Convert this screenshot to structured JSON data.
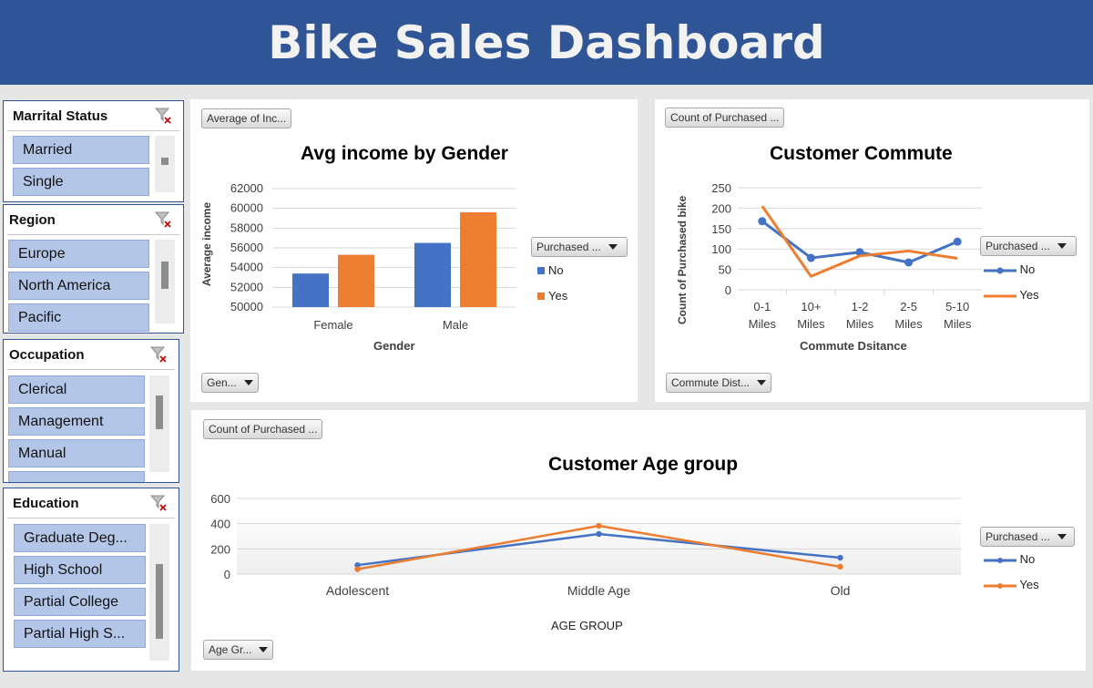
{
  "header": {
    "title": "Bike Sales Dashboard"
  },
  "slicers": [
    {
      "title": "Marrital Status",
      "items": [
        "Married",
        "Single"
      ]
    },
    {
      "title": "Region",
      "items": [
        "Europe",
        "North America",
        "Pacific"
      ]
    },
    {
      "title": "Occupation",
      "items": [
        "Clerical",
        "Management",
        "Manual"
      ]
    },
    {
      "title": "Education",
      "items": [
        "Graduate Deg...",
        "High School",
        "Partial College",
        "Partial High S..."
      ]
    }
  ],
  "colors": {
    "no": "#4472c4",
    "yes": "#ed7d31",
    "header": "#2f5597",
    "slicer_item": "#b4c6e7"
  },
  "charts": {
    "income": {
      "value_button": "Average of Inc...",
      "field_button": "Gen...",
      "legend_button": "Purchased ...",
      "ylabel": "Average income",
      "xlabel": "Gender",
      "legend": [
        "No",
        "Yes"
      ],
      "ticks": [
        "62000",
        "60000",
        "58000",
        "56000",
        "54000",
        "52000",
        "50000"
      ]
    },
    "commute": {
      "value_button": "Count of Purchased ...",
      "field_button": "Commute Dist...",
      "legend_button": "Purchased ...",
      "ylabel": "Count of Purchased bike",
      "xlabel": "Commute Dsitance",
      "legend": [
        "No",
        "Yes"
      ],
      "ticks": [
        "250",
        "200",
        "150",
        "100",
        "50",
        "0"
      ]
    },
    "age": {
      "value_button": "Count of Purchased ...",
      "field_button": "Age Gr...",
      "legend_button": "Purchased ...",
      "xlabel": "AGE GROUP",
      "legend": [
        "No",
        "Yes"
      ],
      "ticks": [
        "600",
        "400",
        "200",
        "0"
      ]
    }
  },
  "chart_data": [
    {
      "type": "bar",
      "title": "Avg income by Gender",
      "xlabel": "Gender",
      "ylabel": "Average income",
      "categories": [
        "Female",
        "Male"
      ],
      "series": [
        {
          "name": "No",
          "values": [
            53400,
            56500
          ]
        },
        {
          "name": "Yes",
          "values": [
            55300,
            59600
          ]
        }
      ],
      "ylim": [
        50000,
        62000
      ],
      "grid": true,
      "legend_position": "right"
    },
    {
      "type": "line",
      "title": "Customer Commute",
      "xlabel": "Commute Dsitance",
      "ylabel": "Count of Purchased bike",
      "categories": [
        "0-1 Miles",
        "10+ Miles",
        "1-2 Miles",
        "2-5 Miles",
        "5-10 Miles"
      ],
      "series": [
        {
          "name": "No",
          "values": [
            168,
            78,
            92,
            67,
            118
          ]
        },
        {
          "name": "Yes",
          "values": [
            205,
            33,
            83,
            95,
            77
          ]
        }
      ],
      "ylim": [
        0,
        250
      ],
      "grid": true,
      "legend_position": "right"
    },
    {
      "type": "line",
      "title": "Customer Age group",
      "xlabel": "AGE GROUP",
      "ylabel": "",
      "categories": [
        "Adolescent",
        "Middle Age",
        "Old"
      ],
      "series": [
        {
          "name": "No",
          "values": [
            71,
            318,
            130
          ]
        },
        {
          "name": "Yes",
          "values": [
            39,
            383,
            59
          ]
        }
      ],
      "ylim": [
        0,
        600
      ],
      "grid": true,
      "legend_position": "right"
    }
  ]
}
